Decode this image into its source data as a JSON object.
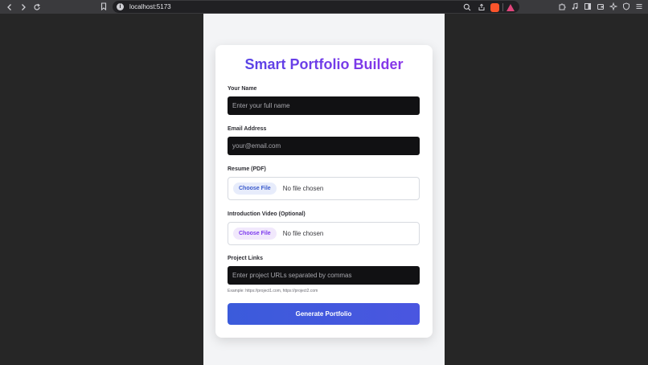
{
  "browser": {
    "url": "localhost:5173",
    "info_icon": "i",
    "icons": {
      "back": "back-icon",
      "forward": "forward-icon",
      "reload": "reload-icon",
      "bookmark": "bookmark-icon",
      "zoom": "zoom-icon",
      "share": "share-icon",
      "brave_shield": "brave-shield-icon",
      "rewards": "rewards-icon",
      "extensions": "extensions-icon",
      "media": "media-icon",
      "sidebar": "sidebar-icon",
      "wallet": "wallet-icon",
      "leo": "leo-icon",
      "vpn": "vpn-icon",
      "menu": "menu-icon"
    }
  },
  "form": {
    "title": "Smart Portfolio Builder",
    "name_label": "Your Name",
    "name_placeholder": "Enter your full name",
    "email_label": "Email Address",
    "email_placeholder": "your@email.com",
    "resume_label": "Resume (PDF)",
    "resume_button": "Choose File",
    "resume_status": "No file chosen",
    "video_label": "Introduction Video (Optional)",
    "video_button": "Choose File",
    "video_status": "No file chosen",
    "links_label": "Project Links",
    "links_placeholder": "Enter project URLs separated by commas",
    "links_hint": "Example: https://project1.com, https://project2.com",
    "submit_label": "Generate Portfolio"
  },
  "colors": {
    "title_gradient_start": "#4f46e5",
    "title_gradient_end": "#9333ea",
    "button": "#3b5bdb",
    "page_background": "#f3f4f6",
    "outer_background": "#262626"
  }
}
